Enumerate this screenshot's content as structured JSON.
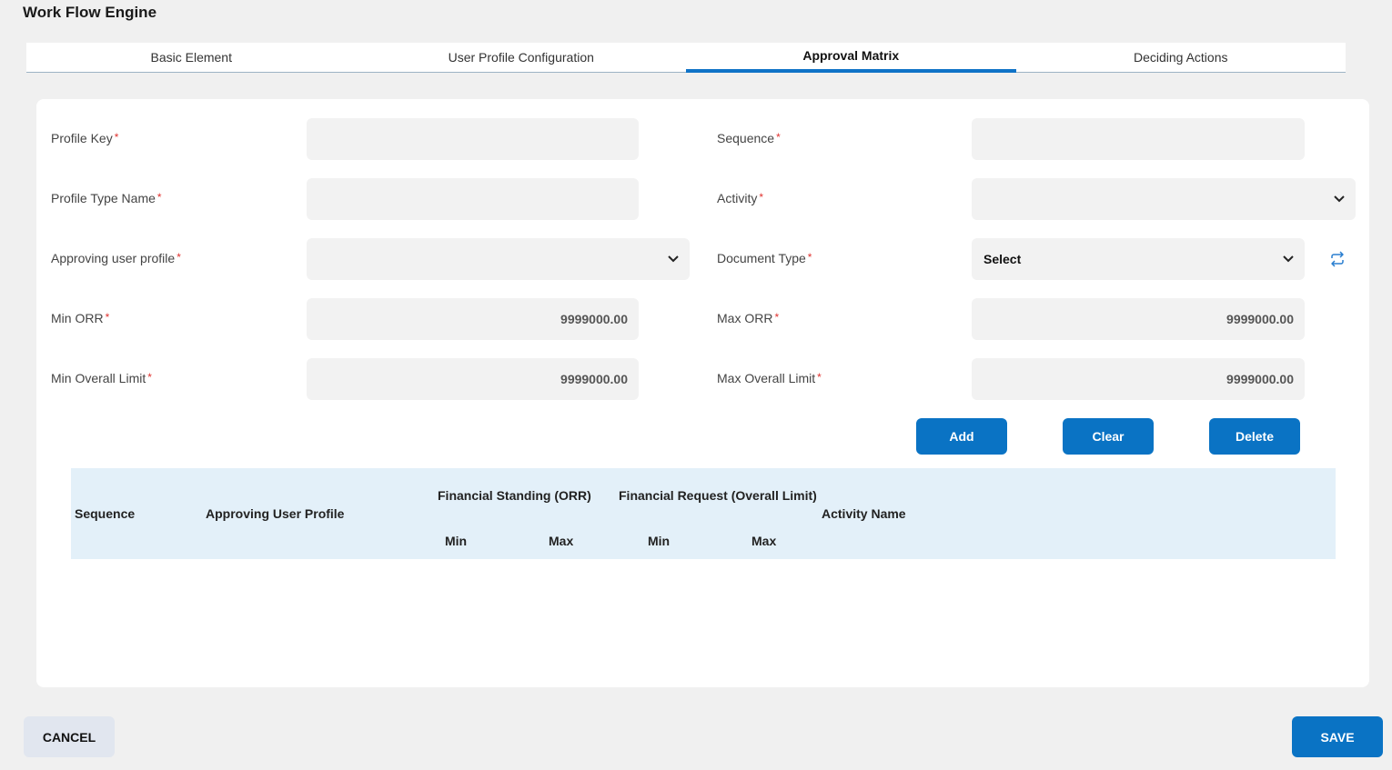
{
  "page": {
    "title": "Work Flow Engine"
  },
  "tabs": [
    {
      "label": "Basic Element"
    },
    {
      "label": "User Profile Configuration"
    },
    {
      "label": "Approval Matrix"
    },
    {
      "label": "Deciding Actions"
    }
  ],
  "form": {
    "profile_key": {
      "label": "Profile Key",
      "required": "*",
      "value": ""
    },
    "sequence": {
      "label": "Sequence",
      "required": "*",
      "value": ""
    },
    "profile_type_name": {
      "label": "Profile Type Name",
      "required": "*",
      "value": ""
    },
    "activity": {
      "label": "Activity",
      "required": "*",
      "value": ""
    },
    "approving_user_profile": {
      "label": "Approving user profile",
      "required": "*",
      "value": ""
    },
    "document_type": {
      "label": "Document Type",
      "required": "*",
      "value": "Select"
    },
    "min_orr": {
      "label": "Min ORR",
      "required": "*",
      "value": "9999000.00"
    },
    "max_orr": {
      "label": "Max ORR",
      "required": "*",
      "value": "9999000.00"
    },
    "min_overall_limit": {
      "label": "Min Overall Limit",
      "required": "*",
      "value": "9999000.00"
    },
    "max_overall_limit": {
      "label": "Max Overall Limit",
      "required": "*",
      "value": "9999000.00"
    }
  },
  "actions": {
    "add": "Add",
    "clear": "Clear",
    "delete": "Delete"
  },
  "grid": {
    "columns": {
      "sequence": "Sequence",
      "approving_user_profile": "Approving User Profile",
      "financial_standing": "Financial Standing (ORR)",
      "financial_request": "Financial Request (Overall Limit)",
      "activity_name": "Activity Name",
      "fs_min": "Min",
      "fs_max": "Max",
      "fr_min": "Min",
      "fr_max": "Max"
    },
    "rows": []
  },
  "footer": {
    "cancel": "CANCEL",
    "save": "SAVE"
  },
  "colors": {
    "accent": "#0a73c4",
    "grid_header": "#e3f0f9",
    "required": "#e0322f"
  },
  "icons": {
    "dropdown": "chevron-down-icon",
    "refresh": "refresh-icon"
  }
}
